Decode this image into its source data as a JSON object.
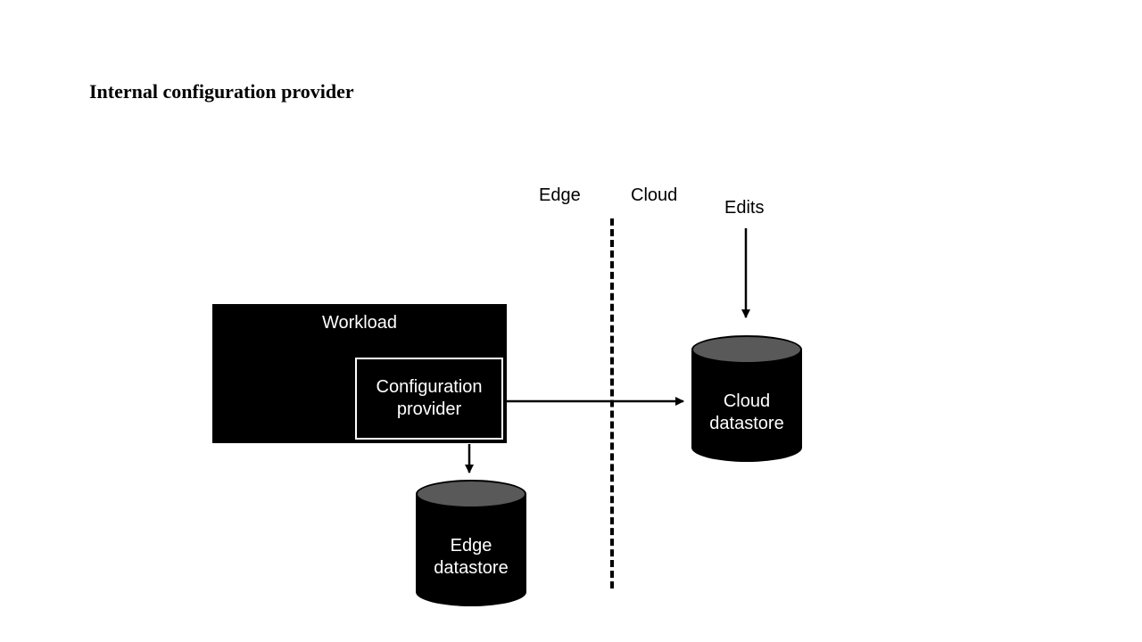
{
  "title": "Internal configuration provider",
  "labels": {
    "edge": "Edge",
    "cloud": "Cloud",
    "edits": "Edits"
  },
  "nodes": {
    "workload": "Workload",
    "config_provider": "Configuration provider",
    "edge_datastore": "Edge datastore",
    "cloud_datastore": "Cloud datastore"
  }
}
